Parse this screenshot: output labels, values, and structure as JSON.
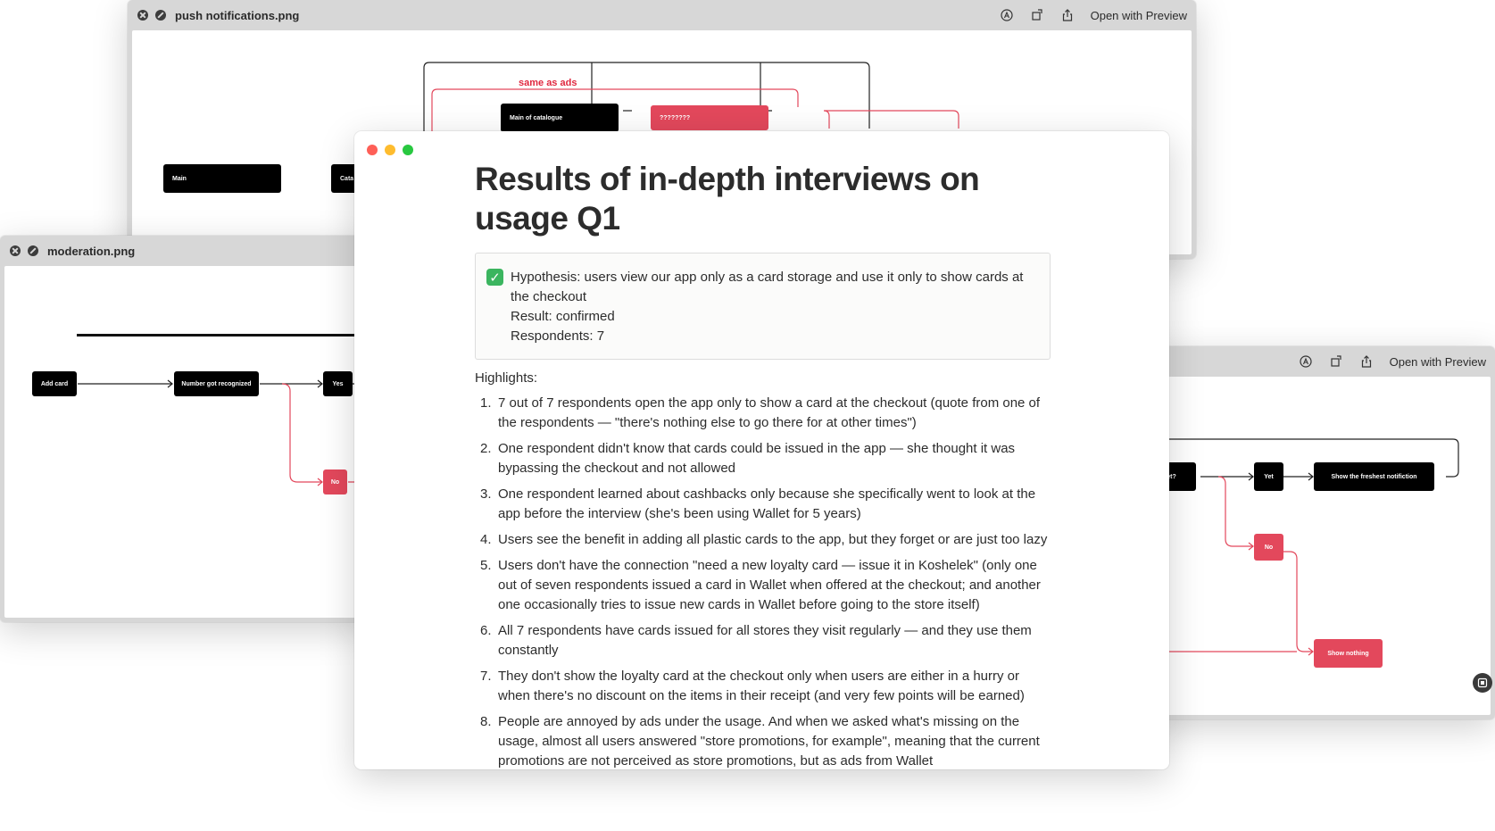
{
  "windows": {
    "push": {
      "filename": "push notifications.png",
      "open_with": "Open with Preview",
      "label_red": "same as ads",
      "nodes": {
        "main": "Main",
        "catalogue": "Cata",
        "main_catalogue": "Main of catalogue",
        "unknown": "????????"
      }
    },
    "moderation": {
      "filename": "moderation.png",
      "nodes": {
        "add_card": "Add card",
        "recognized": "Number got recognized",
        "yes": "Yes",
        "no": "No"
      }
    },
    "right": {
      "open_with": "Open with Preview",
      "nodes": {
        "question": "et?",
        "yet": "Yet",
        "freshest": "Show the freshest notifiction",
        "no": "No",
        "show_nothing": "Show nothing"
      }
    }
  },
  "document": {
    "title": "Results of in-depth interviews on usage Q1",
    "callout": {
      "icon": "check-mark-icon",
      "hypothesis": "Hypothesis: users view our app only as a card storage and use it only to show cards at the checkout",
      "result": "Result: confirmed",
      "respondents": "Respondents: 7"
    },
    "highlights_label": "Highlights:",
    "highlights": [
      {
        "num": "1.",
        "text": "7 out of 7 respondents open the app only to show a card at the checkout (quote from one of the respondents — \"there's nothing else to go there for at other times\")"
      },
      {
        "num": "2.",
        "text": "One respondent didn't know that cards could be issued in the app — she thought it was bypassing the checkout and not allowed"
      },
      {
        "num": "3.",
        "text": "One respondent learned about cashbacks only because she specifically went to look at the app before the interview (she's been using Wallet for 5 years)"
      },
      {
        "num": "4.",
        "text": "Users see the benefit in adding all plastic cards to the app, but they forget or are just too lazy"
      },
      {
        "num": "5.",
        "text": "Users don't have the connection \"need a new loyalty card — issue it in Koshelek\" (only one out of seven respondents issued a card in Wallet when offered at the checkout; and another one occasionally tries to issue new cards in Wallet before going to the store itself)"
      },
      {
        "num": "6.",
        "text": "All 7 respondents have cards issued for all stores they visit regularly — and they use them constantly"
      },
      {
        "num": "7.",
        "text": "They don't show the loyalty card at the checkout only when users are either in a hurry or when there's no discount on the items in their receipt (and very few points will be earned)"
      },
      {
        "num": "8.",
        "text": "People are annoyed by ads under the usage. And when we asked what's missing on the usage, almost all users answered \"store promotions, for example\", meaning that the current promotions are not perceived as store promotions, but as ads from Wallet"
      }
    ]
  }
}
